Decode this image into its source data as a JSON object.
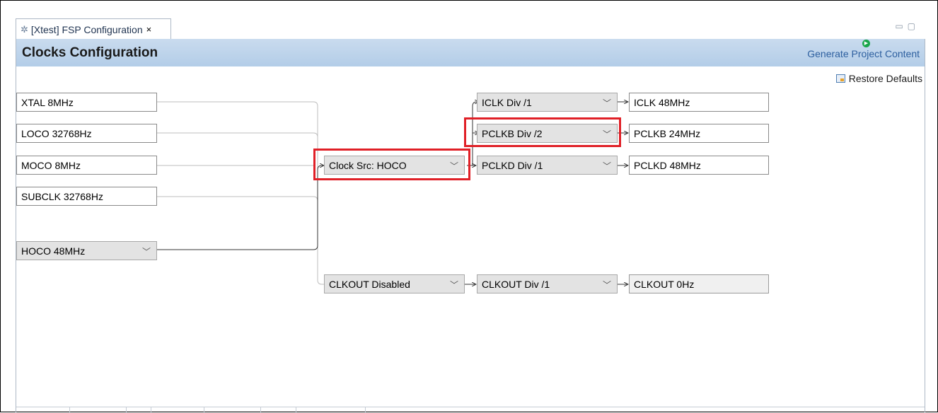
{
  "tab": {
    "icon": "gear-icon",
    "label": "[Xtest] FSP Configuration",
    "close": "×"
  },
  "header": {
    "title": "Clocks Configuration",
    "generate_label": "Generate Project Content",
    "generate_icon": "play-icon"
  },
  "toolbar": {
    "restore_label": "Restore Defaults",
    "restore_icon": "restore-icon"
  },
  "sources": {
    "xtal": "XTAL 8MHz",
    "loco": "LOCO 32768Hz",
    "moco": "MOCO 8MHz",
    "subclk": "SUBCLK 32768Hz",
    "hoco": "HOCO 48MHz"
  },
  "selectors": {
    "clock_src": "Clock Src: HOCO",
    "clkout_src": "CLKOUT Disabled"
  },
  "dividers": {
    "iclk": "ICLK Div /1",
    "pclkb": "PCLKB Div /2",
    "pclkd": "PCLKD Div /1",
    "clkout": "CLKOUT Div /1"
  },
  "outputs": {
    "iclk": "ICLK 48MHz",
    "pclkb": "PCLKB 24MHz",
    "pclkd": "PCLKD 48MHz",
    "clkout": "CLKOUT 0Hz"
  },
  "colors": {
    "header": "#bcd3ec",
    "highlight": "#e02027",
    "link": "#2d5f9f"
  }
}
